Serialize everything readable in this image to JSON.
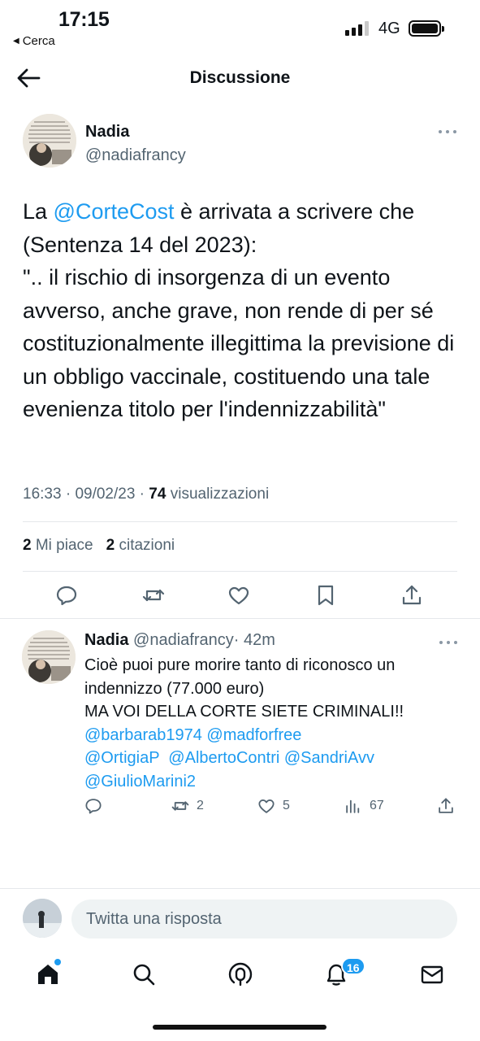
{
  "status_bar": {
    "time": "17:15",
    "back_app": "Cerca",
    "network": "4G"
  },
  "header": {
    "title": "Discussione"
  },
  "main_tweet": {
    "author_name": "Nadia",
    "author_handle": "@nadiafrancy",
    "text_prefix": "La ",
    "mention": "@CorteCost",
    "text_body": " è arrivata a scrivere che (Sentenza 14 del 2023):\n\".. il rischio di insorgenza di un evento avverso, anche grave, non rende di per sé costituzionalmente illegittima la previsione di un obbligo vaccinale, costituendo una tale evenienza titolo per l'indennizzabilità\"",
    "time": "16:33",
    "date": "09/02/23",
    "views_count": "74",
    "views_label": "visualizzazioni",
    "likes_count": "2",
    "likes_label": "Mi piace",
    "quotes_count": "2",
    "quotes_label": "citazioni",
    "actions": [
      "reply-icon",
      "retweet-icon",
      "like-icon",
      "bookmark-icon",
      "share-icon"
    ]
  },
  "reply_tweet": {
    "author_name": "Nadia",
    "author_handle": "@nadiafrancy",
    "age": "· 42m",
    "text": "Cioè puoi pure morire tanto di riconosco un indennizzo (77.000 euro)\nMA VOI DELLA CORTE SIETE CRIMINALI!!",
    "mentions_line1": "@barbarab1974 @madforfree",
    "mentions_line2": "@OrtigiaP  @AlbertoContri @SandriAvv",
    "mentions_line3": "@GiulioMarini2",
    "retweets": "2",
    "likes": "5",
    "views": "67"
  },
  "composer": {
    "placeholder": "Twitta una risposta"
  },
  "tab_bar": {
    "notifications_badge": "16",
    "items": [
      "home-icon",
      "search-icon",
      "spaces-icon",
      "notifications-icon",
      "messages-icon"
    ]
  },
  "colors": {
    "accent": "#1d9bf0",
    "secondary_text": "#536471",
    "primary_text": "#0f1419"
  }
}
